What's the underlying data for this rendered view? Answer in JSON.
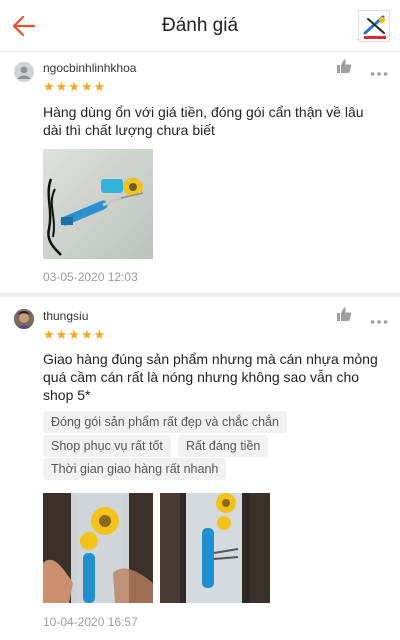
{
  "header": {
    "title": "Đánh giá",
    "accent_color": "#ee4d2d",
    "back_icon": "arrow-left-icon",
    "shop_logo_icon": "shop-logo-icon"
  },
  "reviews": [
    {
      "username": "ngocbinhlinhkhoa",
      "avatar_icon": "default-user-icon",
      "rating": 5,
      "stars": "★★★★★",
      "comment": "Hàng dùng ổn với giá tiền, đóng gói cẩn thận về lâu dài thì chất lượng chưa biết",
      "tags": [],
      "photo_count": 1,
      "timestamp": "03-05-2020 12:03"
    },
    {
      "username": "thungsiu",
      "avatar_icon": "user-photo-icon",
      "rating": 5,
      "stars": "★★★★★",
      "comment": "Giao hàng đúng sản phẩm nhưng mà cán nhựa mỏng quá cầm cán rất là nóng nhưng không sao vẫn cho shop 5*",
      "tags": [
        "Đóng gói sản phẩm rất đẹp và chắc chắn",
        "Shop phục vụ rất tốt",
        "Rất đáng tiền",
        "Thời gian giao hàng rất nhanh"
      ],
      "photo_count": 2,
      "timestamp": "10-04-2020 16:57"
    }
  ],
  "icons": {
    "like": "thumbs-up-icon",
    "more": "more-dots-icon"
  },
  "colors": {
    "star": "#f5a623",
    "tag_bg": "#f1f1f1"
  }
}
